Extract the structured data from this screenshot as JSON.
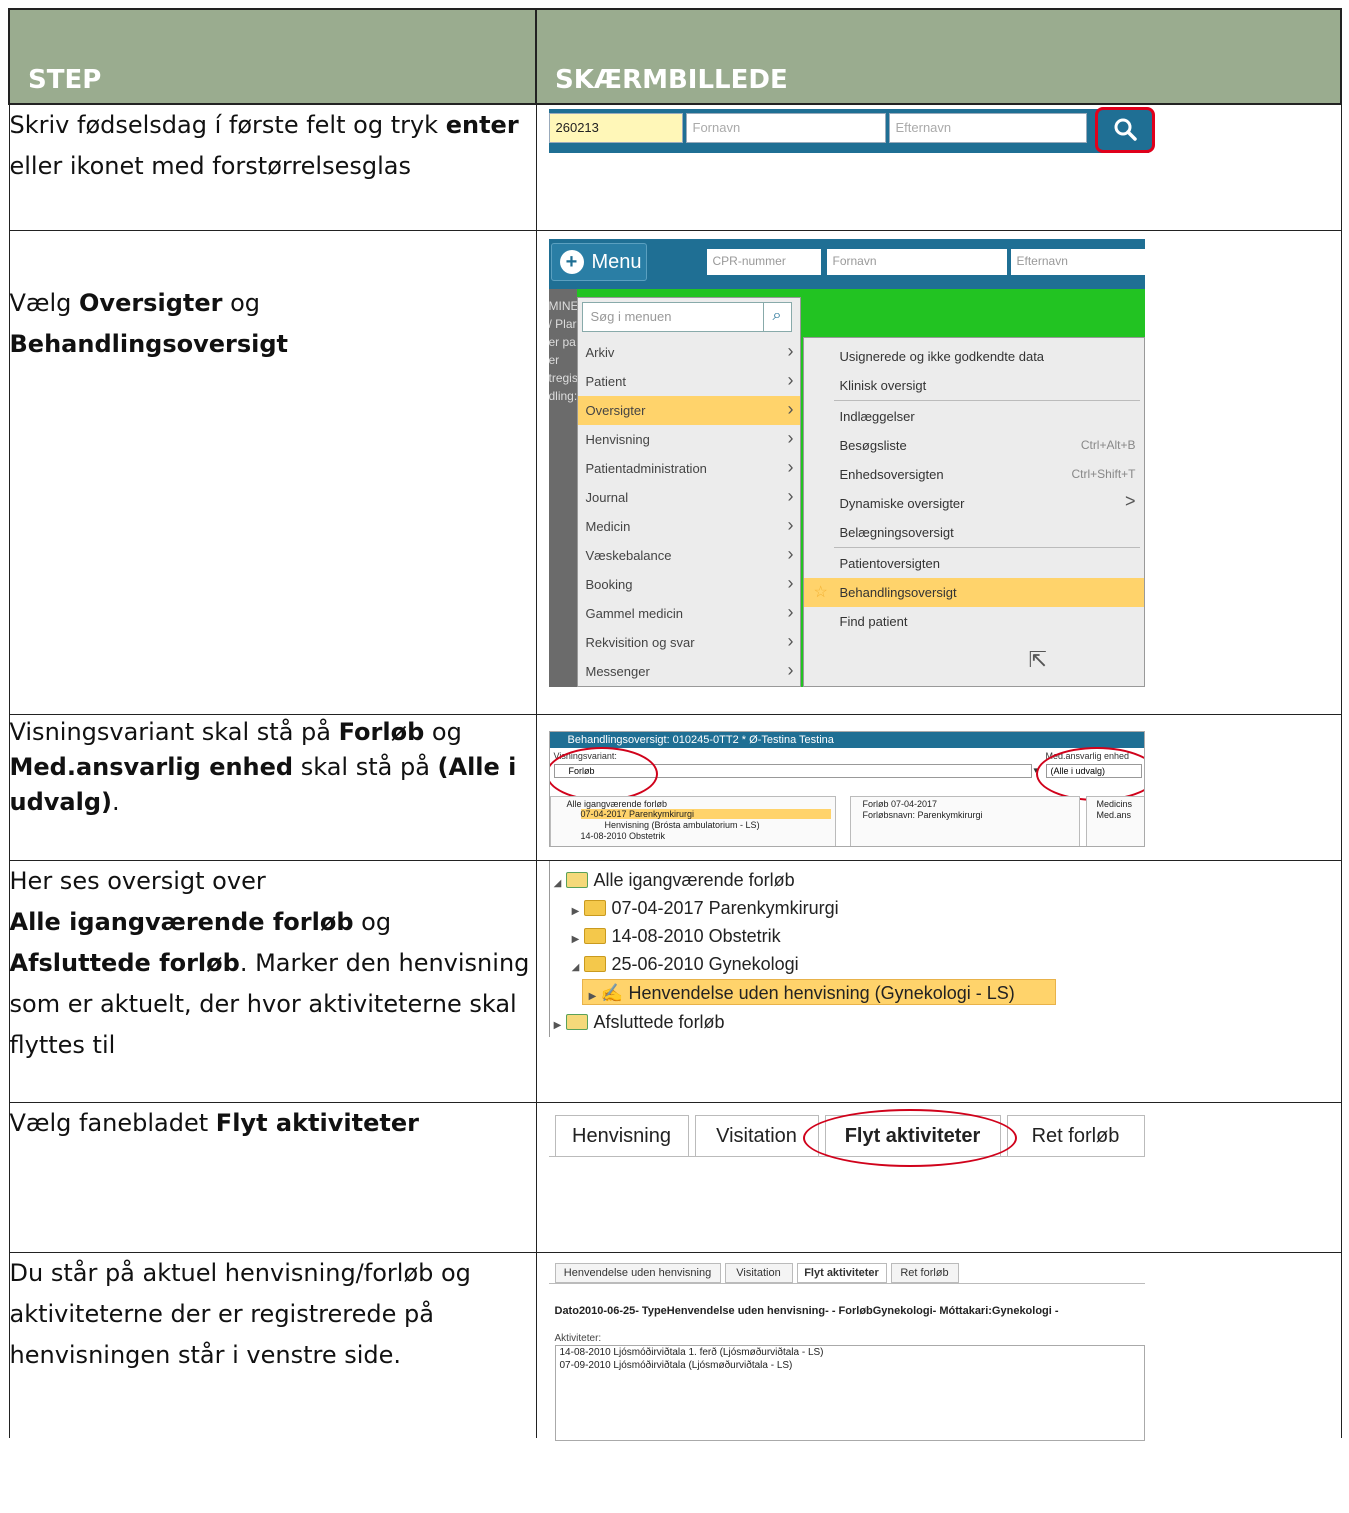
{
  "header": {
    "step": "STEP",
    "screenshot": "SKÆRMBILLEDE"
  },
  "rows": [
    {
      "text": [
        "Skriv fødselsdag í første felt og tryk ",
        "enter",
        " eller ikonet med forstørrelsesglas"
      ],
      "shot": {
        "cpr_value": "260213",
        "fornavn_placeholder": "Fornavn",
        "efternavn_placeholder": "Efternavn"
      }
    },
    {
      "text": [
        "Vælg ",
        "Oversigter",
        " og ",
        "Behandlingsoversigt"
      ],
      "shot": {
        "menu_label": "Menu",
        "cpr_placeholder": "CPR-nummer",
        "fornavn_placeholder": "Fornavn",
        "efternavn_placeholder": "Efternavn",
        "search_placeholder": "Søg i menuen",
        "left_fragments": [
          "MINE",
          "/ Plar",
          "er pa",
          "er",
          "tregis",
          "dling:"
        ],
        "menu_items": [
          "Arkiv",
          "Patient",
          "Oversigter",
          "Henvisning",
          "Patientadministration",
          "Journal",
          "Medicin",
          "Væskebalance",
          "Booking",
          "Gammel medicin",
          "Rekvisition og svar",
          "Messenger"
        ],
        "sub_items": [
          {
            "label": "Usignerede og ikke godkendte data",
            "shortcut": ""
          },
          {
            "label": "Klinisk oversigt",
            "shortcut": ""
          },
          {
            "label": "Indlæggelser",
            "shortcut": ""
          },
          {
            "label": "Besøgsliste",
            "shortcut": "Ctrl+Alt+B"
          },
          {
            "label": "Enhedsoversigten",
            "shortcut": "Ctrl+Shift+T"
          },
          {
            "label": "Dynamiske oversigter",
            "shortcut": ">"
          },
          {
            "label": "Belægningsoversigt",
            "shortcut": ""
          },
          {
            "label": "Patientoversigten",
            "shortcut": ""
          },
          {
            "label": "Behandlingsoversigt",
            "shortcut": ""
          },
          {
            "label": "Find patient",
            "shortcut": ""
          }
        ]
      }
    },
    {
      "text": [
        "Visningsvariant skal stå på ",
        "Forløb",
        " og ",
        "Med.ansvarlig enhed",
        " skal stå på ",
        "(Alle i udvalg)",
        "."
      ],
      "shot": {
        "title": "Behandlingsoversigt: 010245-0TT2 * Ø-Testina Testina",
        "visningsvariant_label": "Visningsvariant:",
        "visningsvariant_value": "Forløb",
        "medans_label": "Med.ansvarlig enhed",
        "medans_value": "(Alle i udvalg)",
        "tree": [
          "Alle igangværende forløb",
          "07-04-2017  Parenkymkirurgi",
          "Henvisning (Brósta ambulatorium - LS)",
          "14-08-2010  Obstetrik"
        ],
        "mid": [
          "Forløb 07-04-2017",
          "Forløbsnavn: Parenkymkirurgi"
        ],
        "right": [
          "Medicins",
          "Med.ans"
        ]
      }
    },
    {
      "text": [
        "Her ses oversigt over ",
        "Alle igangværende forløb",
        " og ",
        "Afsluttede forløb",
        ". Marker den henvisning som er aktuelt, der hvor aktiviteterne skal flyttes til"
      ],
      "shot": {
        "tree": [
          "Alle igangværende forløb",
          "07-04-2017  Parenkymkirurgi",
          "14-08-2010  Obstetrik",
          "25-06-2010  Gynekologi",
          "Henvendelse uden henvisning (Gynekologi - LS)",
          "Afsluttede forløb"
        ]
      }
    },
    {
      "text": [
        "Vælg fanebladet ",
        "Flyt aktiviteter"
      ],
      "shot": {
        "tabs": [
          "Henvisning",
          "Visitation",
          "Flyt aktiviteter",
          "Ret forløb"
        ]
      }
    },
    {
      "text": [
        "Du står på aktuel henvisning/forløb og aktiviteterne der er registrerede på henvisningen står i venstre side."
      ],
      "shot": {
        "tabs": [
          "Henvendelse uden henvisning",
          "Visitation",
          "Flyt aktiviteter",
          "Ret forløb"
        ],
        "info": "Dato2010-06-25- TypeHenvendelse uden henvisning- - ForløbGynekologi- Móttakari:Gynekologi -",
        "aktiviteter_label": "Aktiviteter:",
        "aktiviteter": [
          "14-08-2010 Ljósmóðirviðtala 1. ferð (Ljósmøðurviðtala - LS)",
          "07-09-2010 Ljósmóðirviðtala (Ljósmøðurviðtala - LS)"
        ]
      }
    }
  ],
  "colors": {
    "header_bg": "#9aac8f",
    "bar_blue": "#1f6f94",
    "highlight": "#ffd36b",
    "annotation_red": "#d0021b",
    "menu_green": "#22c322"
  }
}
